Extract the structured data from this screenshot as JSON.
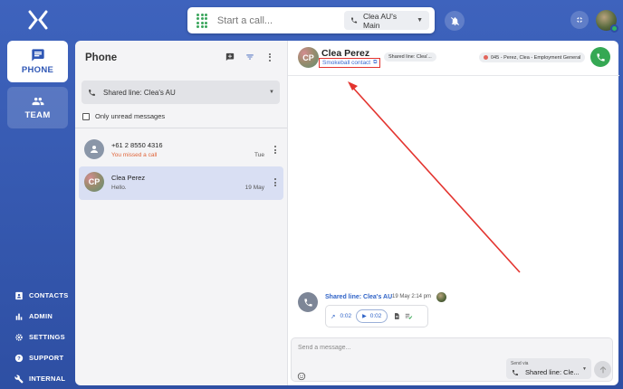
{
  "topbar": {
    "call_placeholder": "Start a call...",
    "line_label": "Clea AU's Main"
  },
  "nav": {
    "phone_label": "PHONE",
    "team_label": "TEAM",
    "links": [
      {
        "label": "CONTACTS",
        "icon": "contacts-icon"
      },
      {
        "label": "ADMIN",
        "icon": "bar-chart-icon"
      },
      {
        "label": "SETTINGS",
        "icon": "gear-icon"
      },
      {
        "label": "SUPPORT",
        "icon": "help-icon"
      },
      {
        "label": "INTERNAL",
        "icon": "wrench-icon"
      }
    ]
  },
  "list": {
    "title": "Phone",
    "shared_line": "Shared line: Clea's AU",
    "unread_label": "Only unread messages",
    "conversations": [
      {
        "name": "+61 2 8550 4316",
        "preview": "You missed a call",
        "date": "Tue",
        "avatar": "person-icon"
      },
      {
        "name": "Clea Perez",
        "preview": "Hello.",
        "date": "19 May",
        "initials": "CP"
      }
    ]
  },
  "chat": {
    "initials": "CP",
    "name": "Clea Perez",
    "contact_link": "Smokeball contact",
    "shared_chip": "Shared line: Clea'...",
    "matter_chip": "045 - Perez, Clea - Employment General",
    "message": {
      "from": "Shared line: Clea's AU",
      "time": "19 May 2:14 pm",
      "duration": "0:02",
      "play_duration": "0:02"
    },
    "composer_placeholder": "Send a message...",
    "send_via_label": "Send via",
    "send_via_value": "Shared line: Cle..."
  },
  "colors": {
    "accent": "#2f57b5",
    "call_green": "#35a853",
    "annotation_red": "#e3342f"
  }
}
